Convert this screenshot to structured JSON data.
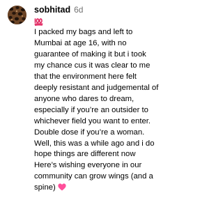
{
  "comment": {
    "username": "sobhitad",
    "timestamp": "6d",
    "text": "I packed my bags and left to\nMumbai at age 16, with no\nguarantee of making it but i took\nmy chance cus it was clear to me\nthat the environment here felt\ndeeply resistant and judgemental of\nanyone who dares to dream,\nespecially if you’re an outsider to\nwhichever field you want to enter.\nDouble dose if you’re a woman.\nWell, this was a while ago and i do\nhope things are different now\nHere’s wishing everyone in our\ncommunity can grow wings (and a\nspine)",
    "leading_emoji": "hundred-points-icon",
    "trailing_emoji": "pink-heart-icon"
  },
  "colors": {
    "text": "#000000",
    "timestamp": "#737373",
    "emoji_red": "#e0245e",
    "heart_pink": "#ff4f9a"
  }
}
